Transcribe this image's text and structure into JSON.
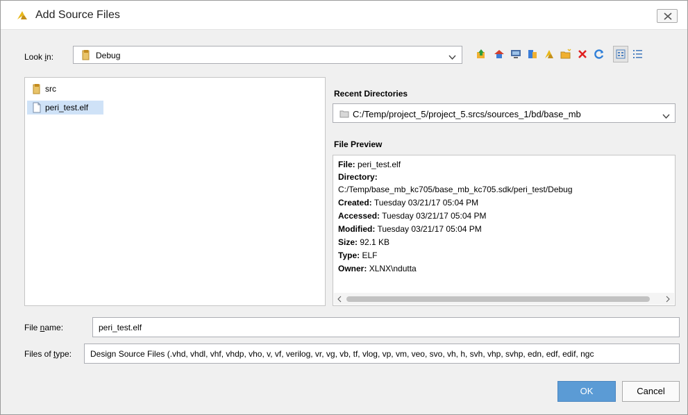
{
  "window": {
    "title": "Add Source Files",
    "close_icon": "close-icon"
  },
  "lookin": {
    "label_pre": "Look ",
    "label_mnemonic": "i",
    "label_post": "n:",
    "value": "Debug"
  },
  "toolbar": {
    "icons": [
      "up-folder-icon",
      "home-icon",
      "desktop-icon",
      "project-icon",
      "favorites-icon",
      "new-folder-icon",
      "delete-icon",
      "refresh-icon",
      "list-view-icon",
      "details-view-icon"
    ]
  },
  "files": [
    {
      "name": "src",
      "type": "folder"
    },
    {
      "name": "peri_test.elf",
      "type": "file",
      "selected": true
    }
  ],
  "recent": {
    "label": "Recent Directories",
    "value": "C:/Temp/project_5/project_5.srcs/sources_1/bd/base_mb"
  },
  "preview": {
    "label": "File Preview",
    "file_key": "File:",
    "file_val": "peri_test.elf",
    "dir_key": "Directory:",
    "dir_val": "C:/Temp/base_mb_kc705/base_mb_kc705.sdk/peri_test/Debug",
    "created_key": "Created:",
    "created_val": "Tuesday 03/21/17 05:04 PM",
    "accessed_key": "Accessed:",
    "accessed_val": "Tuesday 03/21/17 05:04 PM",
    "modified_key": "Modified:",
    "modified_val": "Tuesday 03/21/17 05:04 PM",
    "size_key": "Size:",
    "size_val": "92.1 KB",
    "type_key": "Type:",
    "type_val": "ELF",
    "owner_key": "Owner:",
    "owner_val": "XLNX\\ndutta"
  },
  "filename": {
    "label_pre": "File ",
    "label_mnemonic": "n",
    "label_post": "ame:",
    "value": "peri_test.elf"
  },
  "filetype": {
    "label_pre": "Files of ",
    "label_mnemonic": "t",
    "label_post": "ype:",
    "value": "Design Source Files (.vhd, vhdl, vhf, vhdp, vho, v, vf, verilog, vr, vg, vb, tf, vlog, vp, vm, veo, svo, vh, h, svh, vhp, svhp, edn, edf, edif, ngc"
  },
  "buttons": {
    "ok": "OK",
    "cancel": "Cancel"
  },
  "colors": {
    "accent": "#5b9bd5",
    "selection": "#cfe2f7",
    "delete": "#e02020"
  }
}
